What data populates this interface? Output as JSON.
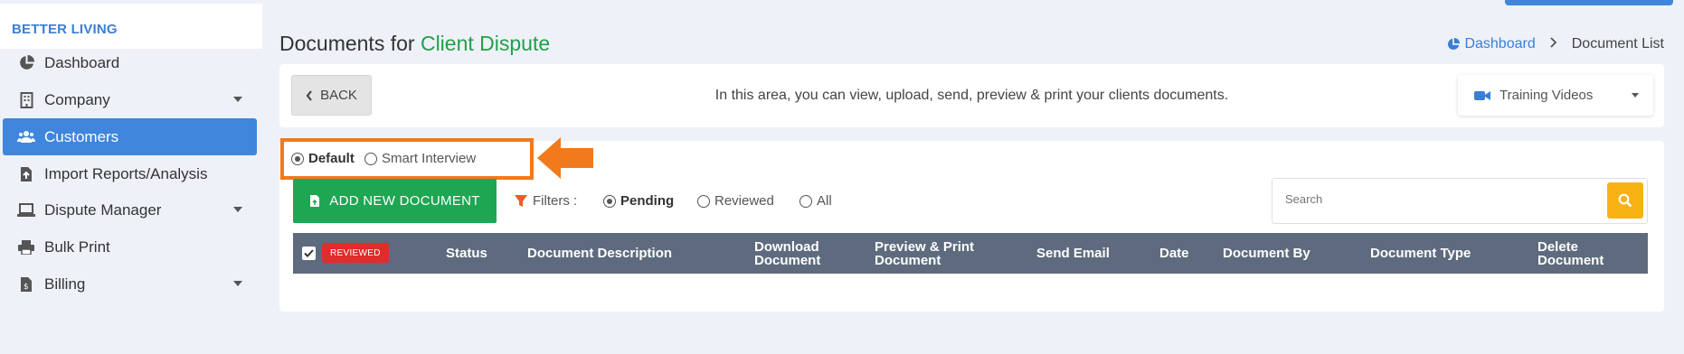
{
  "brand": "BETTER LIVING",
  "sidebar": {
    "items": [
      {
        "label": "Dashboard",
        "icon": "pie-chart-icon"
      },
      {
        "label": "Company",
        "icon": "building-icon",
        "has_caret": true
      },
      {
        "label": "Customers",
        "icon": "users-icon",
        "active": true
      },
      {
        "label": "Import Reports/Analysis",
        "icon": "file-import-icon"
      },
      {
        "label": "Dispute Manager",
        "icon": "laptop-icon",
        "has_caret": true
      },
      {
        "label": "Bulk Print",
        "icon": "printer-icon"
      },
      {
        "label": "Billing",
        "icon": "invoice-icon",
        "has_caret": true
      }
    ]
  },
  "header": {
    "title_prefix": "Documents for",
    "title_accent": "Client Dispute",
    "breadcrumb": {
      "home": "Dashboard",
      "current": "Document List"
    }
  },
  "info_bar": {
    "back_label": "BACK",
    "message": "In this area, you can view, upload, send, preview & print your clients documents.",
    "training_label": "Training Videos"
  },
  "mode": {
    "options": [
      {
        "label": "Default",
        "checked": true
      },
      {
        "label": "Smart Interview",
        "checked": false
      }
    ]
  },
  "toolbar": {
    "add_label": "ADD NEW DOCUMENT",
    "filters_label": "Filters :",
    "filters": [
      {
        "label": "Pending",
        "checked": true
      },
      {
        "label": "Reviewed",
        "checked": false
      },
      {
        "label": "All",
        "checked": false
      }
    ],
    "search_placeholder": "Search"
  },
  "table": {
    "badge": "REVIEWED",
    "columns": [
      "Status",
      "Document Description",
      "Download Document",
      "Preview & Print Document",
      "Send Email",
      "Date",
      "Document By",
      "Document Type",
      "Delete Document"
    ]
  },
  "colors": {
    "accent_blue": "#3f86dc",
    "accent_green": "#22a04b",
    "highlight_orange": "#f07a1c",
    "search_yellow": "#f9b213",
    "header_gray": "#5e6b7e",
    "badge_red": "#e22b2b"
  }
}
